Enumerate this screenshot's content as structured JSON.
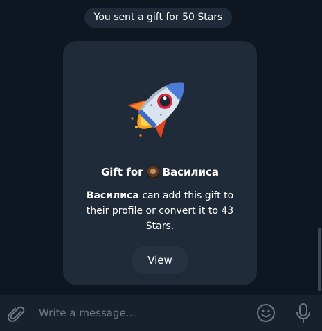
{
  "service_message": "You sent a gift for 50 Stars",
  "gift": {
    "title_prefix": "Gift for",
    "recipient": "Василиса",
    "description_rest": "can add this gift to their profile or convert it to 43 Stars.",
    "view_label": "View",
    "sticker_icon": "rocket-icon"
  },
  "composer": {
    "placeholder": "Write a message...",
    "attach_icon": "paperclip-icon",
    "emoji_icon": "smile-icon",
    "mic_icon": "microphone-icon"
  },
  "colors": {
    "background": "#0e1621",
    "bubble": "#1f2b38",
    "composer": "#17212b",
    "placeholder": "#6c7883"
  }
}
